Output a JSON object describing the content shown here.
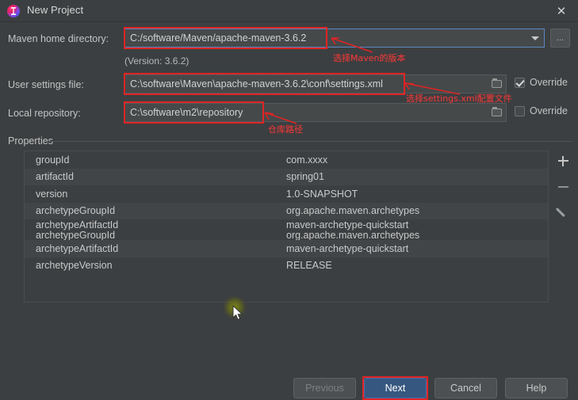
{
  "window": {
    "title": "New Project",
    "app_icon": "intellij-idea-icon",
    "close_label": "✕"
  },
  "form": {
    "maven_home_label": "Maven home directory:",
    "maven_home_value": "C:/software/Maven/apache-maven-3.6.2",
    "maven_version_note": "(Version: 3.6.2)",
    "dropdown_icon": "chevron-down-icon",
    "browse_label": "...",
    "settings_label": "User settings file:",
    "settings_value": "C:\\software\\Maven\\apache-maven-3.6.2\\conf\\settings.xml",
    "settings_override_label": "Override",
    "settings_override_checked": true,
    "repo_label": "Local repository:",
    "repo_value": "C:\\software\\m2\\repository",
    "repo_override_label": "Override",
    "repo_override_checked": false,
    "folder_icon": "folder-icon"
  },
  "properties": {
    "section_label": "Properties",
    "rows": [
      {
        "key": "groupId",
        "value": "com.xxxx"
      },
      {
        "key": "artifactId",
        "value": "spring01"
      },
      {
        "key": "version",
        "value": "1.0-SNAPSHOT"
      },
      {
        "key": "archetypeGroupId",
        "value": "org.apache.maven.archetypes"
      },
      {
        "key": "archetypeArtifactId",
        "value": "maven-archetype-quickstart"
      },
      {
        "key": "archetypeGroupId",
        "value": "org.apache.maven.archetypes"
      },
      {
        "key": "archetypeArtifactId",
        "value": "maven-archetype-quickstart"
      },
      {
        "key": "archetypeVersion",
        "value": "RELEASE"
      }
    ],
    "tools": [
      {
        "name": "add-property-button",
        "icon": "plus-icon"
      },
      {
        "name": "remove-property-button",
        "icon": "minus-icon"
      },
      {
        "name": "edit-property-button",
        "icon": "pencil-icon"
      }
    ]
  },
  "buttons": {
    "previous": "Previous",
    "next": "Next",
    "cancel": "Cancel",
    "help": "Help"
  },
  "annotations": {
    "maven_version": "选择Maven的版本",
    "settings_file": "选择settings.xml配置文件",
    "repo_path": "仓库路径"
  },
  "colors": {
    "dialog_background": "#3c3f41",
    "field_background": "#45494a",
    "focus_border": "#5a88c4",
    "primary_button": "#365880",
    "annotation_red": "#e02424",
    "text": "#c4c4c4",
    "cursor_glow": "#848c14"
  }
}
